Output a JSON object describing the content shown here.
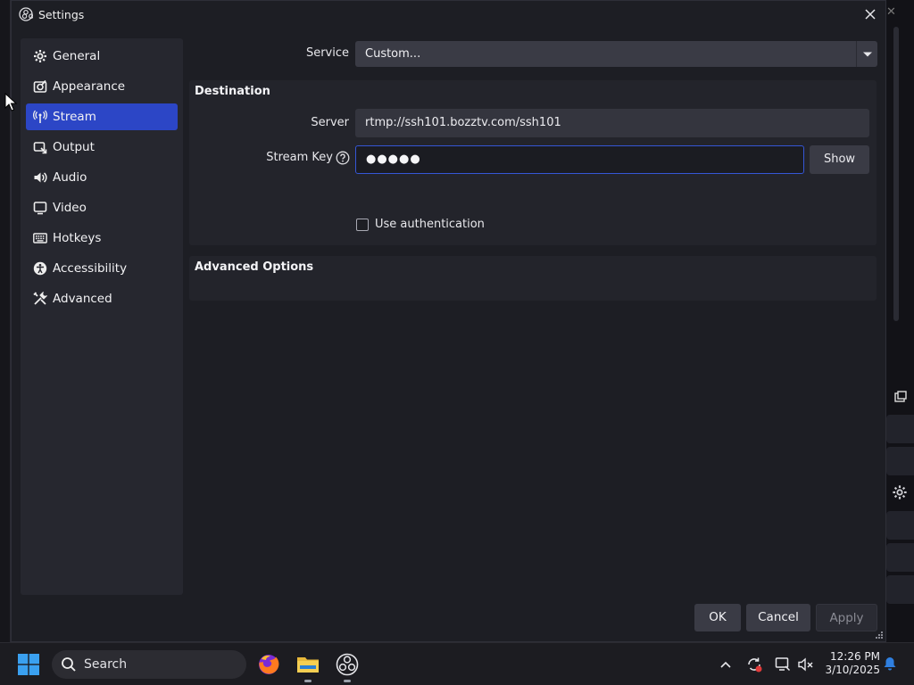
{
  "window": {
    "title": "Settings"
  },
  "sidebar": {
    "items": [
      {
        "label": "General",
        "icon": "gear-icon"
      },
      {
        "label": "Appearance",
        "icon": "palette-icon"
      },
      {
        "label": "Stream",
        "icon": "antenna-icon",
        "active": true
      },
      {
        "label": "Output",
        "icon": "output-icon"
      },
      {
        "label": "Audio",
        "icon": "speaker-icon"
      },
      {
        "label": "Video",
        "icon": "monitor-icon"
      },
      {
        "label": "Hotkeys",
        "icon": "keyboard-icon"
      },
      {
        "label": "Accessibility",
        "icon": "accessibility-icon"
      },
      {
        "label": "Advanced",
        "icon": "tools-icon"
      }
    ]
  },
  "stream": {
    "service_label": "Service",
    "service_value": "Custom...",
    "destination_title": "Destination",
    "server_label": "Server",
    "server_value": "rtmp://ssh101.bozztv.com/ssh101",
    "key_label": "Stream Key",
    "key_value": "●●●●●",
    "show_label": "Show",
    "use_auth_label": "Use authentication",
    "use_auth_checked": false,
    "advanced_title": "Advanced Options"
  },
  "buttons": {
    "ok": "OK",
    "cancel": "Cancel",
    "apply": "Apply"
  },
  "taskbar": {
    "search_placeholder": "Search",
    "time": "12:26 PM",
    "date": "3/10/2025"
  },
  "colors": {
    "accent": "#2c46c6",
    "window_bg": "#1d1e24",
    "focus_border": "#3556d6"
  }
}
